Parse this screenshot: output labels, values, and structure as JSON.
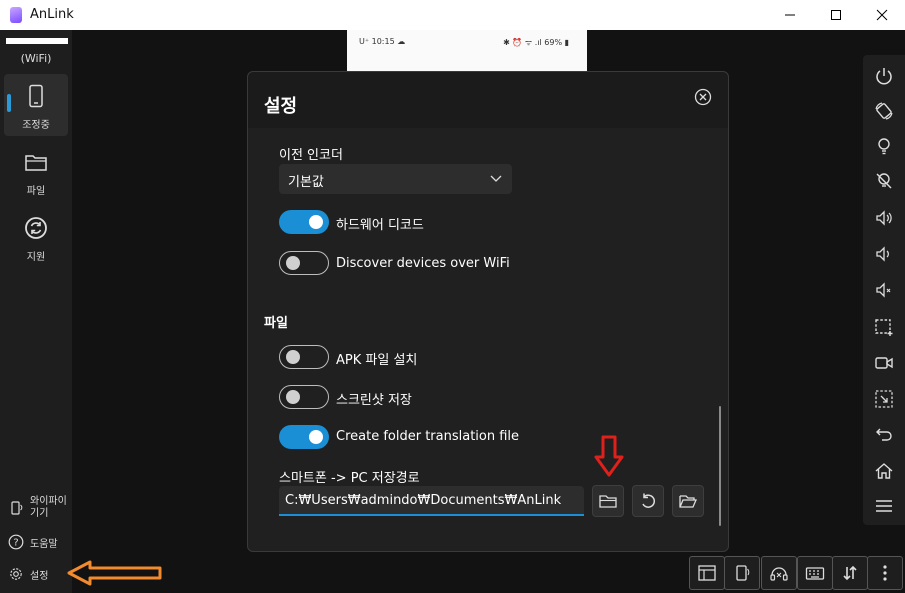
{
  "window": {
    "title": "AnLink",
    "minimize": "minimize",
    "maximize": "maximize",
    "close": "close"
  },
  "sidebar": {
    "connection": "(WiFi)",
    "items": [
      {
        "label": "조정중",
        "icon": "phone-icon",
        "active": true
      },
      {
        "label": "파일",
        "icon": "folder-icon",
        "active": false
      },
      {
        "label": "지원",
        "icon": "refresh-icon",
        "active": false
      }
    ],
    "bottom": [
      {
        "label": "와이파이 기기",
        "icon": "wifi-device-icon"
      },
      {
        "label": "도움말",
        "icon": "help-icon"
      },
      {
        "label": "설정",
        "icon": "gear-icon"
      }
    ]
  },
  "phone_preview": {
    "time": "U⁺ 10:15 ☁",
    "status": "✱ ⏰ ᯤ .ıl 69% ▮"
  },
  "settings": {
    "title": "설정",
    "encoder_label": "이전 인코더",
    "encoder_value": "기본값",
    "hardware_decode": {
      "label": "하드웨어 디코드",
      "on": true
    },
    "discover_wifi": {
      "label": "Discover devices over WiFi",
      "on": false
    },
    "file_section": "파일",
    "install_apk": {
      "label": "APK 파일 설치",
      "on": false
    },
    "save_screenshot": {
      "label": "스크린샷 저장",
      "on": false
    },
    "create_folder_translation": {
      "label": "Create folder translation file",
      "on": true
    },
    "save_path_label": "스마트폰 -> PC 저장경로",
    "save_path_value": "C:₩Users₩admindo₩Documents₩AnLink"
  },
  "right_toolbar": [
    "power-icon",
    "rotate-icon",
    "light-on-icon",
    "light-off-icon",
    "volume-up-icon",
    "volume-down-icon",
    "mute-icon",
    "screenshot-region-icon",
    "record-icon",
    "crop-icon",
    "back-icon",
    "home-icon",
    "menu-icon"
  ],
  "bottom_toolbar": [
    "layout-icon",
    "phone-rotate-icon",
    "audio-icon",
    "keyboard-icon",
    "transfer-icon",
    "more-icon"
  ],
  "colors": {
    "accent": "#1a8fd6",
    "annotation_red": "#e0201b",
    "annotation_orange": "#f28a2e"
  }
}
